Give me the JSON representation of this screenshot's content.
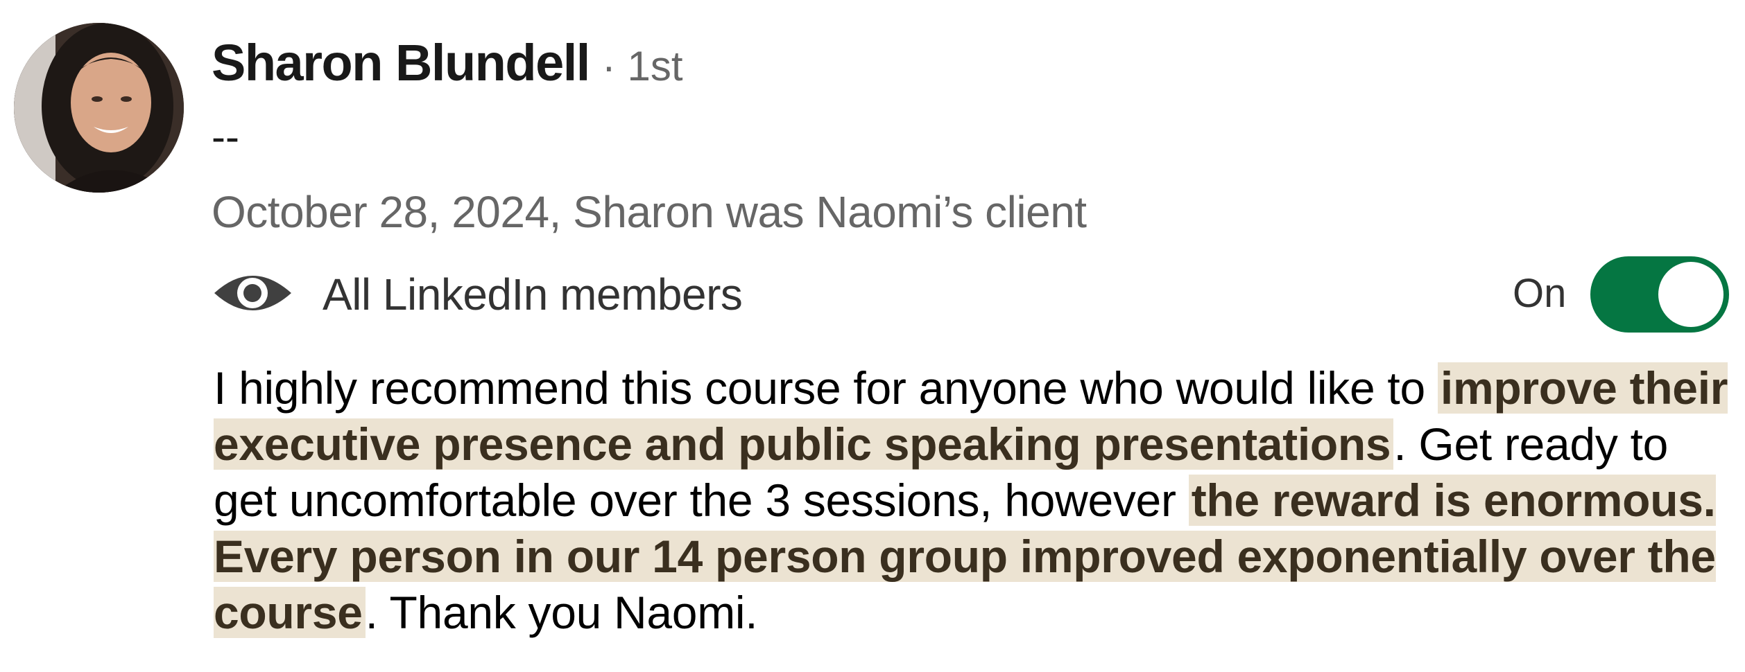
{
  "recommendation": {
    "author_name": "Sharon Blundell",
    "connection_degree": "· 1st",
    "headline": "--",
    "meta": "October 28, 2024, Sharon was Naomi’s client",
    "visibility": {
      "icon": "eye-icon",
      "label": "All LinkedIn members",
      "toggle_state": "On",
      "toggle_color": "#057642"
    },
    "text_segments": [
      {
        "text": "I highly recommend this course for anyone who would like to ",
        "highlight": false
      },
      {
        "text": "improve their executive presence and public speaking presentations",
        "highlight": true
      },
      {
        "text": ". Get ready to get uncomfortable over the 3 sessions, however ",
        "highlight": false
      },
      {
        "text": "the reward is enormous. Every person in our 14 person group improved exponentially over the course",
        "highlight": true
      },
      {
        "text": ". Thank you Naomi.",
        "highlight": false
      }
    ],
    "highlight_color": "#ece3d2"
  }
}
